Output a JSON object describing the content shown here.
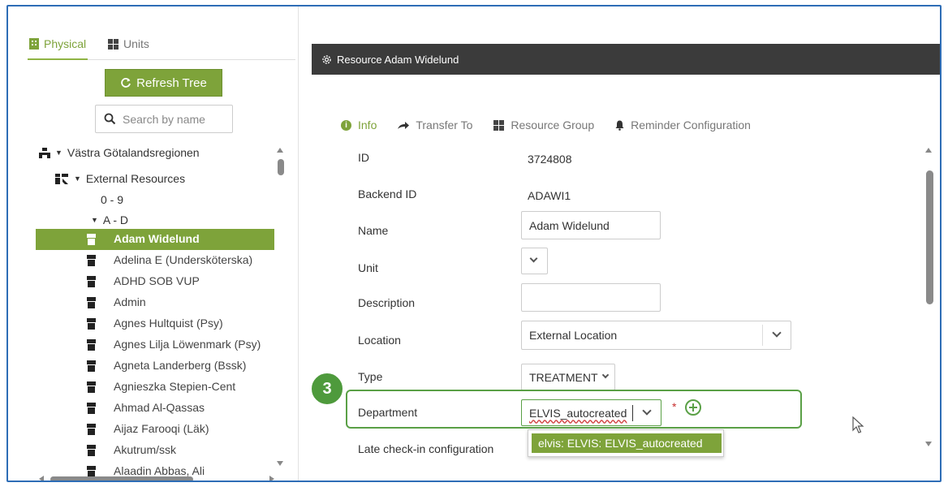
{
  "left_panel": {
    "tabs": [
      {
        "label": "Physical",
        "icon": "building-icon",
        "active": true
      },
      {
        "label": "Units",
        "icon": "grid-icon",
        "active": false
      }
    ],
    "refresh_label": "Refresh Tree",
    "search_placeholder": "Search by name",
    "tree": {
      "root": "Västra Götalandsregionen",
      "group": "External Resources",
      "range_0_9": "0 - 9",
      "range_a_d": "A - D",
      "resources": [
        "Adam Widelund",
        "Adelina E (Undersköterska)",
        "ADHD SOB VUP",
        "Admin",
        "Agnes Hultquist (Psy)",
        "Agnes Lilja Löwenmark (Psy)",
        "Agneta Landerberg (Bssk)",
        "Agnieszka Stepien-Cent",
        "Ahmad Al-Qassas",
        "Aijaz Farooqi (Läk)",
        "Akutrum/ssk",
        "Alaadin Abbas, Ali"
      ],
      "selected_index": 0
    }
  },
  "right_panel": {
    "header_title": "Resource Adam Widelund",
    "tabs": [
      {
        "label": "Info",
        "icon": "info-icon",
        "active": true
      },
      {
        "label": "Transfer To",
        "icon": "share-arrow-icon",
        "active": false
      },
      {
        "label": "Resource Group",
        "icon": "grid-icon",
        "active": false
      },
      {
        "label": "Reminder Configuration",
        "icon": "bell-icon",
        "active": false
      }
    ],
    "form": {
      "id_label": "ID",
      "id_value": "3724808",
      "backend_label": "Backend ID",
      "backend_value": "ADAWI1",
      "name_label": "Name",
      "name_value": "Adam Widelund",
      "unit_label": "Unit",
      "description_label": "Description",
      "description_value": "",
      "location_label": "Location",
      "location_value": "External Location",
      "type_label": "Type",
      "type_value": "TREATMENT",
      "department_label": "Department",
      "department_value": "ELVIS_autocreated",
      "required_mark": "*",
      "late_label": "Late check-in configuration"
    },
    "dropdown_option": "elvis: ELVIS: ELVIS_autocreated",
    "step_number": "3"
  },
  "colors": {
    "accent_green": "#7ea33a",
    "highlight_green": "#5aa046",
    "header_dark": "#3b3b3b",
    "frame_blue": "#2e6db6"
  }
}
